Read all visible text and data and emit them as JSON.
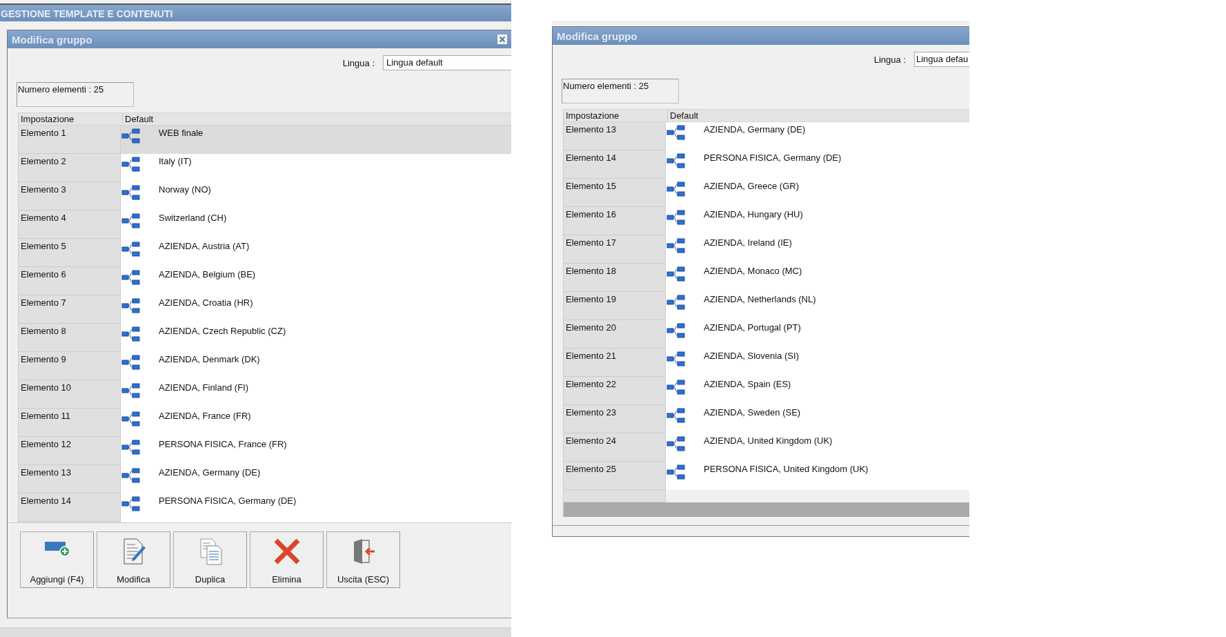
{
  "panels": [
    {
      "app_title": "GESTIONE TEMPLATE E CONTENUTI",
      "dialog_title": "Modifica gruppo",
      "closable": true,
      "lingua_label": "Lingua :",
      "lingua_value": "Lingua default",
      "count": "Numero elementi : 25",
      "columns": [
        "Impostazione",
        "Default"
      ],
      "rows": [
        {
          "name": "Elemento 1",
          "value": "WEB finale",
          "selected": true
        },
        {
          "name": "Elemento 2",
          "value": "Italy (IT)",
          "selected": false
        },
        {
          "name": "Elemento 3",
          "value": "Norway (NO)",
          "selected": false
        },
        {
          "name": "Elemento 4",
          "value": "Switzerland (CH)",
          "selected": false
        },
        {
          "name": "Elemento 5",
          "value": "AZIENDA, Austria (AT)",
          "selected": false
        },
        {
          "name": "Elemento 6",
          "value": "AZIENDA, Belgium (BE)",
          "selected": false
        },
        {
          "name": "Elemento 7",
          "value": "AZIENDA, Croatia (HR)",
          "selected": false
        },
        {
          "name": "Elemento 8",
          "value": "AZIENDA, Czech Republic (CZ)",
          "selected": false
        },
        {
          "name": "Elemento 9",
          "value": "AZIENDA, Denmark (DK)",
          "selected": false
        },
        {
          "name": "Elemento 10",
          "value": "AZIENDA, Finland (FI)",
          "selected": false
        },
        {
          "name": "Elemento 11",
          "value": "AZIENDA, France (FR)",
          "selected": false
        },
        {
          "name": "Elemento 12",
          "value": "PERSONA FISICA, France (FR)",
          "selected": false
        },
        {
          "name": "Elemento 13",
          "value": "AZIENDA, Germany (DE)",
          "selected": false
        },
        {
          "name": "Elemento 14",
          "value": "PERSONA FISICA, Germany (DE)",
          "selected": false
        }
      ],
      "buttons": [
        {
          "label": "Aggiungi (F4)",
          "kind": "add"
        },
        {
          "label": "Modifica",
          "kind": "edit"
        },
        {
          "label": "Duplica",
          "kind": "copy"
        },
        {
          "label": "Elimina",
          "kind": "delete"
        },
        {
          "label": "Uscita (ESC)",
          "kind": "exit"
        }
      ]
    },
    {
      "dialog_title": "Modifica gruppo",
      "closable": false,
      "lingua_label": "Lingua :",
      "lingua_value": "Lingua defau",
      "count": "Numero elementi : 25",
      "columns": [
        "Impostazione",
        "Default"
      ],
      "rows": [
        {
          "name": "Elemento 13",
          "value": "AZIENDA, Germany (DE)",
          "selected": false
        },
        {
          "name": "Elemento 14",
          "value": "PERSONA FISICA, Germany (DE)",
          "selected": false
        },
        {
          "name": "Elemento 15",
          "value": "AZIENDA, Greece (GR)",
          "selected": false
        },
        {
          "name": "Elemento 16",
          "value": "AZIENDA, Hungary (HU)",
          "selected": false
        },
        {
          "name": "Elemento 17",
          "value": "AZIENDA, Ireland (IE)",
          "selected": false
        },
        {
          "name": "Elemento 18",
          "value": "AZIENDA, Monaco (MC)",
          "selected": false
        },
        {
          "name": "Elemento 19",
          "value": "AZIENDA, Netherlands (NL)",
          "selected": false
        },
        {
          "name": "Elemento 20",
          "value": "AZIENDA, Portugal (PT)",
          "selected": false
        },
        {
          "name": "Elemento 21",
          "value": "AZIENDA, Slovenia (SI)",
          "selected": false
        },
        {
          "name": "Elemento 22",
          "value": "AZIENDA, Spain (ES)",
          "selected": false
        },
        {
          "name": "Elemento 23",
          "value": "AZIENDA, Sweden (SE)",
          "selected": false
        },
        {
          "name": "Elemento 24",
          "value": "AZIENDA, United Kingdom (UK)",
          "selected": false
        },
        {
          "name": "Elemento 25",
          "value": "PERSONA FISICA, United Kingdom (UK)",
          "selected": false
        }
      ]
    }
  ]
}
